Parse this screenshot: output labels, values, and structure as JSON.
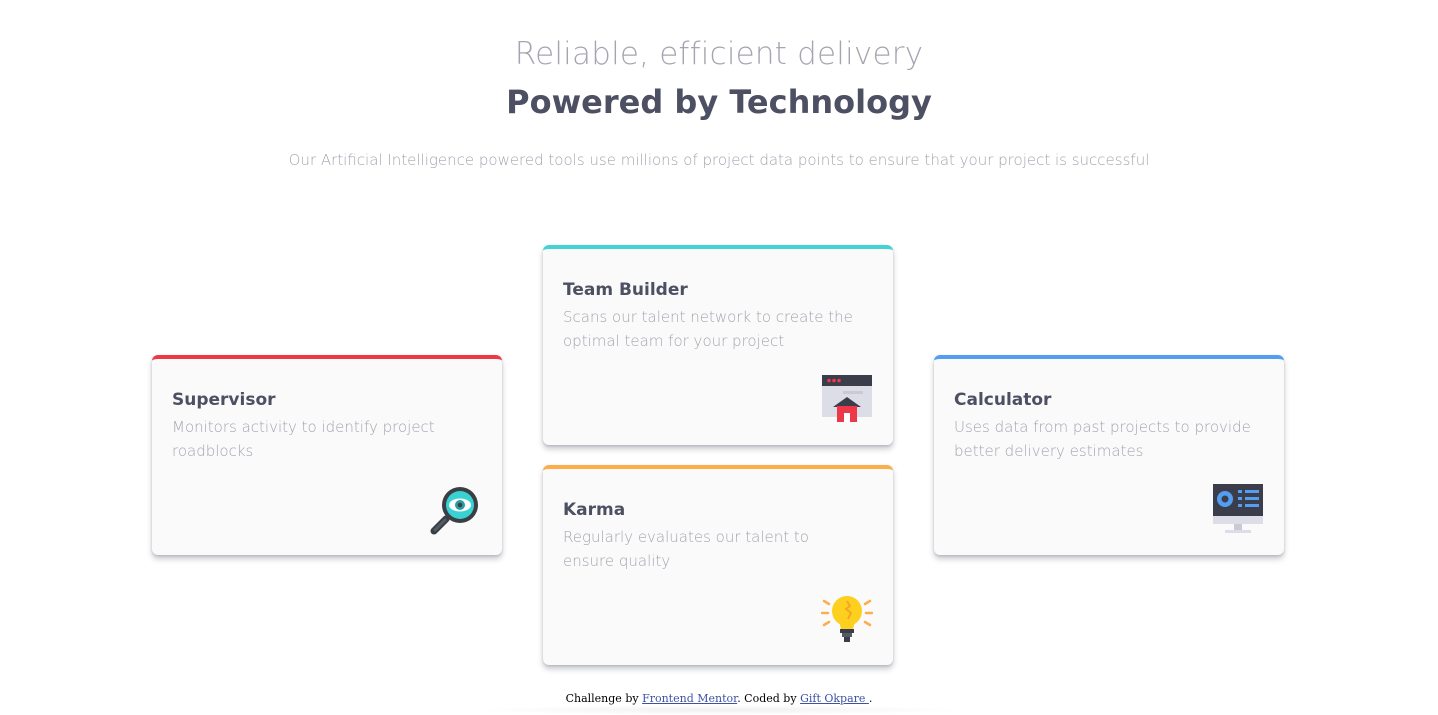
{
  "header": {
    "headline_light": "Reliable, efficient delivery",
    "headline_bold": "Powered by Technology",
    "subhead": "Our Artificial Intelligence powered tools use millions of project data points to ensure that your project is successful"
  },
  "cards": {
    "supervisor": {
      "title": "Supervisor",
      "description": "Monitors activity to identify project roadblocks",
      "icon": "magnifier-eye-icon",
      "accent": "#ec3847"
    },
    "team_builder": {
      "title": "Team Builder",
      "description": "Scans our talent network to create the optimal team for your project",
      "icon": "browser-house-icon",
      "accent": "#44d3d2"
    },
    "karma": {
      "title": "Karma",
      "description": "Regularly evaluates our talent to ensure quality",
      "icon": "lightbulb-icon",
      "accent": "#fcae4a"
    },
    "calculator": {
      "title": "Calculator",
      "description": "Uses data from past projects to provide better delivery estimates",
      "icon": "monitor-chart-icon",
      "accent": "#549ef2"
    }
  },
  "footer": {
    "prefix": "Challenge by ",
    "link1": "Frontend Mentor",
    "middle": ". Coded by ",
    "link2": "Gift Okpare ",
    "suffix": "."
  }
}
